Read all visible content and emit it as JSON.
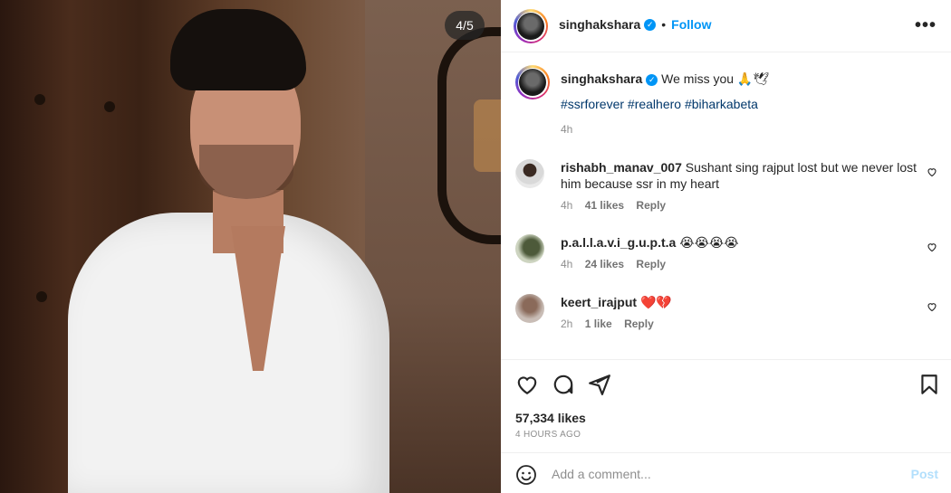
{
  "photo": {
    "counter": "4/5"
  },
  "header": {
    "username": "singhakshara",
    "separator": "•",
    "follow_label": "Follow",
    "more_icon": "more-options-icon"
  },
  "caption": {
    "username": "singhakshara",
    "text": "We miss you 🙏🕊",
    "hashtags": "#ssrforever #realhero #biharkabeta",
    "time": "4h"
  },
  "comments": [
    {
      "username": "rishabh_manav_007",
      "text": "Sushant sing rajput lost but we never lost him because ssr in my heart",
      "time": "4h",
      "likes": "41 likes",
      "reply": "Reply"
    },
    {
      "username": "p.a.l.l.a.v.i_g.u.p.t.a",
      "text": "😭😭😭😭",
      "time": "4h",
      "likes": "24 likes",
      "reply": "Reply"
    },
    {
      "username": "keert_irajput",
      "text": "❤️💔",
      "time": "2h",
      "likes": "1 like",
      "reply": "Reply"
    }
  ],
  "actions": {
    "likes": "57,334 likes",
    "posted": "4 HOURS AGO"
  },
  "add_comment": {
    "placeholder": "Add a comment...",
    "post_label": "Post"
  },
  "colors": {
    "accent": "#0095f6",
    "hashtag": "#00376b",
    "muted": "#8e8e8e"
  }
}
